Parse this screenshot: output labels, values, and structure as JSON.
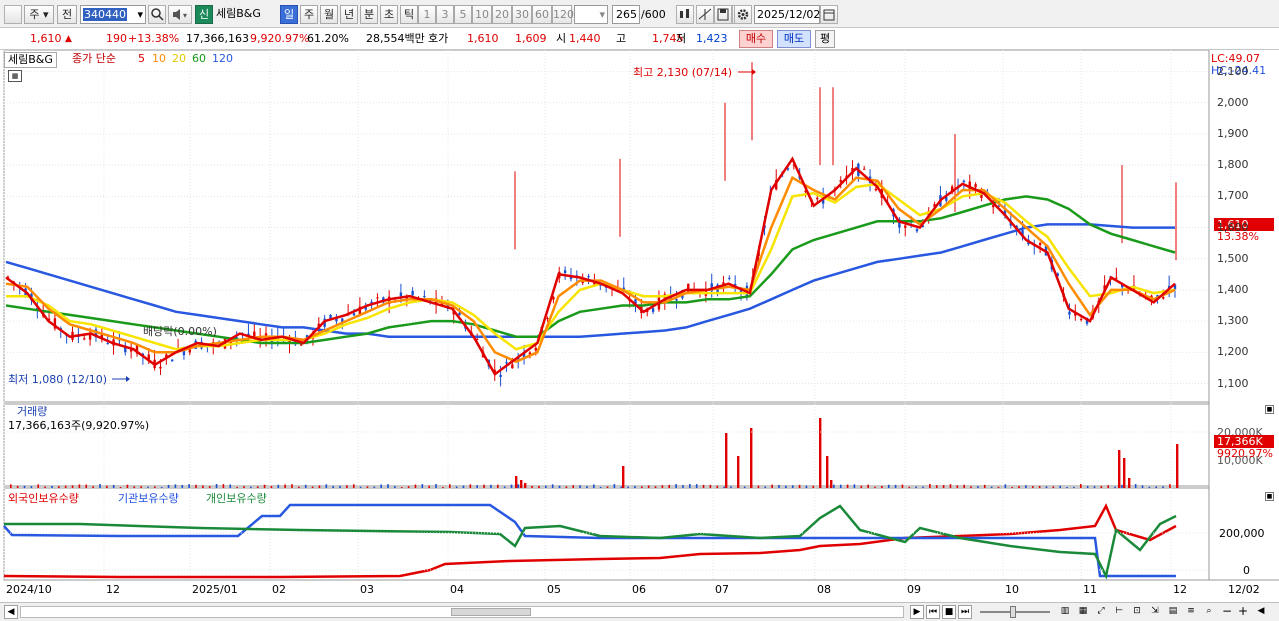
{
  "toolbar": {
    "period_day": "주",
    "prev": "전",
    "code": "340440",
    "market_badge": "신",
    "stock_name": "세림B&G",
    "periods": [
      "일",
      "주",
      "월",
      "년",
      "분",
      "초",
      "틱"
    ],
    "minutes": [
      "1",
      "3",
      "5",
      "10",
      "20",
      "30",
      "60",
      "120"
    ],
    "count": "265",
    "count_total": "/600",
    "date": "2025/12/02"
  },
  "quote": {
    "price": "1,610",
    "change": "190",
    "change_pct": "+13.38%",
    "volume": "17,366,163",
    "volume_ratio": "9,920.97%",
    "turnover": "61.20%",
    "amount": "28,554백만",
    "bid_label": "호가",
    "ask": "1,610",
    "bid": "1,609",
    "open_label": "시",
    "open": "1,440",
    "high_label": "고",
    "high": "1,745",
    "low_label": "저",
    "low": "1,423",
    "buy_btn": "매수",
    "sell_btn": "매도",
    "eval_btn": "평"
  },
  "legend": {
    "name": "세림B&G",
    "close_label": "종가 단순",
    "ma5": "5",
    "ma10": "10",
    "ma20": "20",
    "ma60": "60",
    "ma120": "120"
  },
  "price_panel": {
    "lc": "LC:49.07",
    "hc": "HC:-24.41",
    "max_label": "최고 2,130 (07/14)",
    "min_label": "최저 1,080 (12/10)",
    "div_label": "배당락(0.00%)",
    "cur_price": "1,610",
    "cur_pct": "13.38%",
    "ticks": [
      "2,100",
      "2,000",
      "1,900",
      "1,800",
      "1,700",
      "1,600",
      "1,500",
      "1,400",
      "1,300",
      "1,200",
      "1,100"
    ]
  },
  "volume_panel": {
    "title": "거래량",
    "value": "17,366,163주(9,920.97%)",
    "ticks": [
      "20,000K",
      "10,000K"
    ],
    "cur": "17,366K",
    "cur_pct": "9920.97%"
  },
  "holding_panel": {
    "foreign": "외국인보유수량",
    "inst": "기관보유수량",
    "indiv": "개인보유수량",
    "ticks": [
      "200,000",
      "0"
    ]
  },
  "xaxis": [
    "2024/10",
    "12",
    "2025/01",
    "02",
    "03",
    "04",
    "05",
    "06",
    "07",
    "08",
    "09",
    "10",
    "11",
    "12",
    "12/02"
  ],
  "colors": {
    "up": "#e00000",
    "down": "#1a4fd0",
    "ma5": "#e00000",
    "ma10": "#ff8c00",
    "ma20": "#f7e400",
    "ma60": "#1a9a1a",
    "ma120": "#2858e0"
  },
  "chart_data": {
    "type": "candlestick",
    "ylim": [
      1060,
      2150
    ],
    "series": [
      {
        "name": "5",
        "values": [
          1440,
          1390,
          1300,
          1250,
          1260,
          1230,
          1210,
          1160,
          1200,
          1230,
          1220,
          1260,
          1240,
          1250,
          1230,
          1300,
          1320,
          1350,
          1370,
          1380,
          1360,
          1340,
          1250,
          1130,
          1180,
          1230,
          1450,
          1440,
          1420,
          1390,
          1330,
          1370,
          1400,
          1400,
          1420,
          1390,
          1720,
          1820,
          1670,
          1720,
          1790,
          1730,
          1620,
          1600,
          1690,
          1740,
          1710,
          1640,
          1560,
          1520,
          1340,
          1300,
          1440,
          1400,
          1360,
          1420
        ]
      },
      {
        "name": "10",
        "values": [
          1420,
          1410,
          1340,
          1290,
          1270,
          1250,
          1230,
          1200,
          1200,
          1220,
          1230,
          1240,
          1250,
          1250,
          1240,
          1270,
          1300,
          1330,
          1360,
          1370,
          1370,
          1350,
          1300,
          1200,
          1170,
          1200,
          1380,
          1430,
          1430,
          1400,
          1360,
          1360,
          1390,
          1400,
          1410,
          1400,
          1600,
          1760,
          1720,
          1690,
          1760,
          1750,
          1660,
          1610,
          1660,
          1720,
          1720,
          1660,
          1600,
          1540,
          1420,
          1320,
          1400,
          1400,
          1370,
          1400
        ]
      },
      {
        "name": "20",
        "values": [
          1380,
          1380,
          1350,
          1300,
          1290,
          1270,
          1250,
          1230,
          1210,
          1220,
          1220,
          1230,
          1240,
          1240,
          1240,
          1260,
          1290,
          1310,
          1340,
          1360,
          1370,
          1360,
          1320,
          1260,
          1210,
          1230,
          1330,
          1400,
          1420,
          1400,
          1380,
          1380,
          1390,
          1390,
          1390,
          1390,
          1530,
          1700,
          1710,
          1680,
          1730,
          1740,
          1690,
          1640,
          1660,
          1700,
          1710,
          1680,
          1620,
          1570,
          1470,
          1380,
          1390,
          1410,
          1390,
          1400
        ]
      },
      {
        "name": "60",
        "values": [
          1350,
          1340,
          1330,
          1320,
          1310,
          1300,
          1290,
          1280,
          1270,
          1260,
          1250,
          1240,
          1230,
          1230,
          1230,
          1240,
          1250,
          1260,
          1280,
          1290,
          1300,
          1300,
          1290,
          1270,
          1250,
          1250,
          1300,
          1330,
          1340,
          1350,
          1350,
          1360,
          1360,
          1370,
          1370,
          1380,
          1450,
          1530,
          1560,
          1580,
          1600,
          1620,
          1620,
          1620,
          1630,
          1650,
          1670,
          1690,
          1700,
          1690,
          1660,
          1610,
          1580,
          1560,
          1540,
          1520
        ]
      },
      {
        "name": "120",
        "values": [
          1490,
          1470,
          1450,
          1430,
          1410,
          1390,
          1370,
          1350,
          1330,
          1320,
          1310,
          1300,
          1290,
          1280,
          1280,
          1270,
          1260,
          1260,
          1250,
          1250,
          1250,
          1250,
          1250,
          1250,
          1250,
          1250,
          1250,
          1250,
          1255,
          1260,
          1265,
          1270,
          1280,
          1300,
          1320,
          1340,
          1370,
          1400,
          1430,
          1450,
          1470,
          1490,
          1500,
          1510,
          1520,
          1540,
          1560,
          1580,
          1600,
          1610,
          1610,
          1610,
          1605,
          1600,
          1600,
          1600
        ]
      }
    ]
  }
}
